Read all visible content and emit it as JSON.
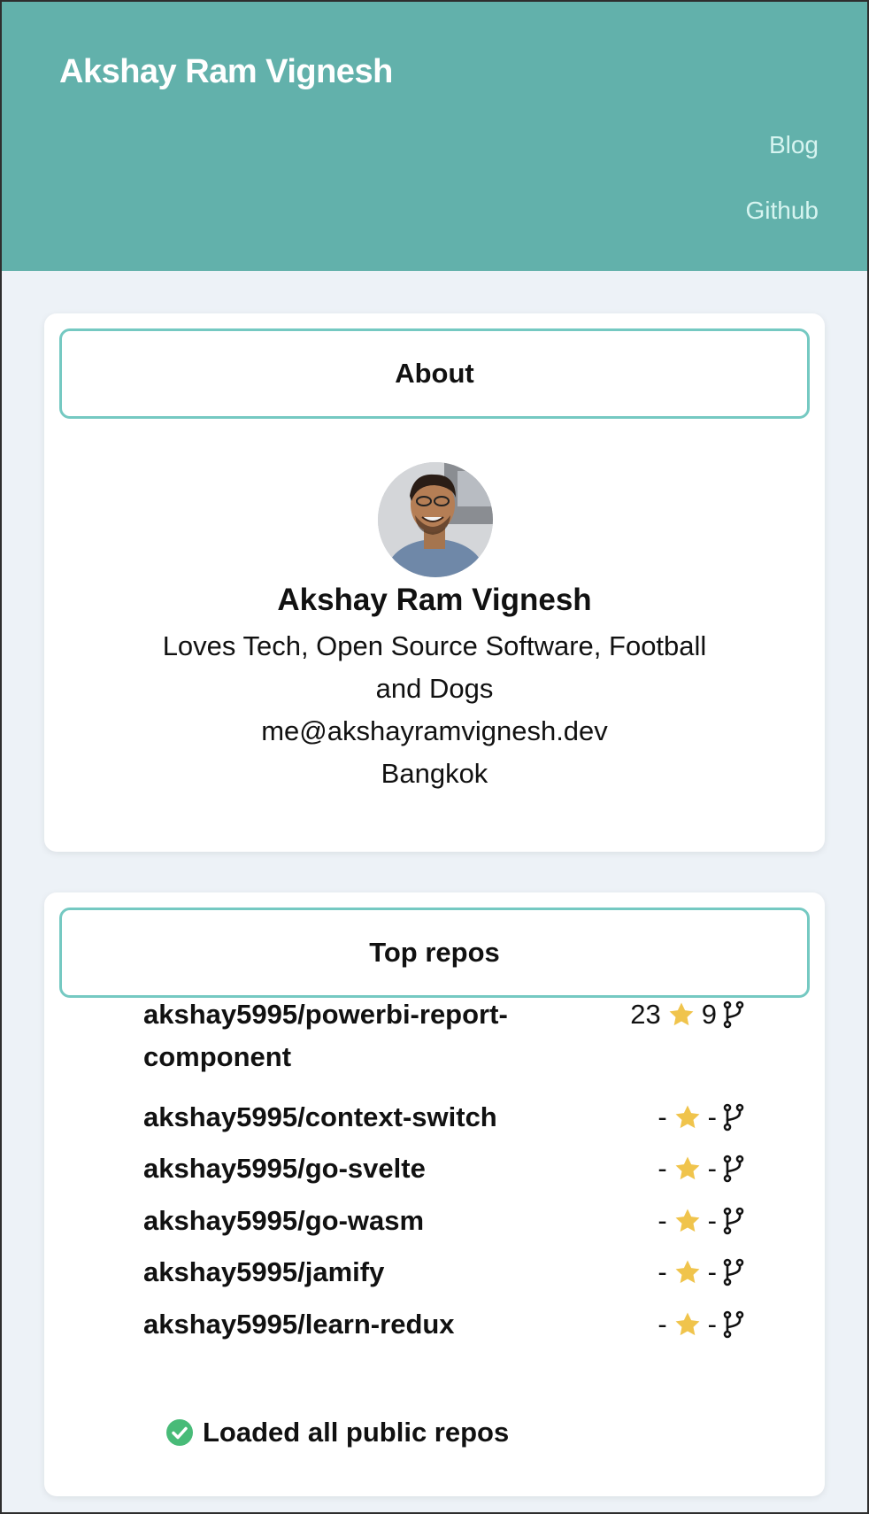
{
  "header": {
    "title": "Akshay Ram Vignesh",
    "nav": {
      "blog": "Blog",
      "github": "Github"
    }
  },
  "about": {
    "heading": "About",
    "avatar_icon": "avatar-photo",
    "name": "Akshay Ram Vignesh",
    "bio": "Loves Tech, Open Source Software, Football and Dogs",
    "email": "me@akshayramvignesh.dev",
    "location": "Bangkok"
  },
  "repos": {
    "heading": "Top repos",
    "items": [
      {
        "name": "akshay5995/powerbi-report-component",
        "stars": "23",
        "forks": "9"
      },
      {
        "name": "akshay5995/context-switch",
        "stars": "-",
        "forks": "-"
      },
      {
        "name": "akshay5995/go-svelte",
        "stars": "-",
        "forks": "-"
      },
      {
        "name": "akshay5995/go-wasm",
        "stars": "-",
        "forks": "-"
      },
      {
        "name": "akshay5995/jamify",
        "stars": "-",
        "forks": "-"
      },
      {
        "name": "akshay5995/learn-redux",
        "stars": "-",
        "forks": "-"
      }
    ],
    "status": "Loaded all public repos"
  },
  "colors": {
    "header_bg": "#62b1ab",
    "accent_border": "#75c9c2",
    "star": "#f0c44c",
    "success": "#48bb78"
  }
}
